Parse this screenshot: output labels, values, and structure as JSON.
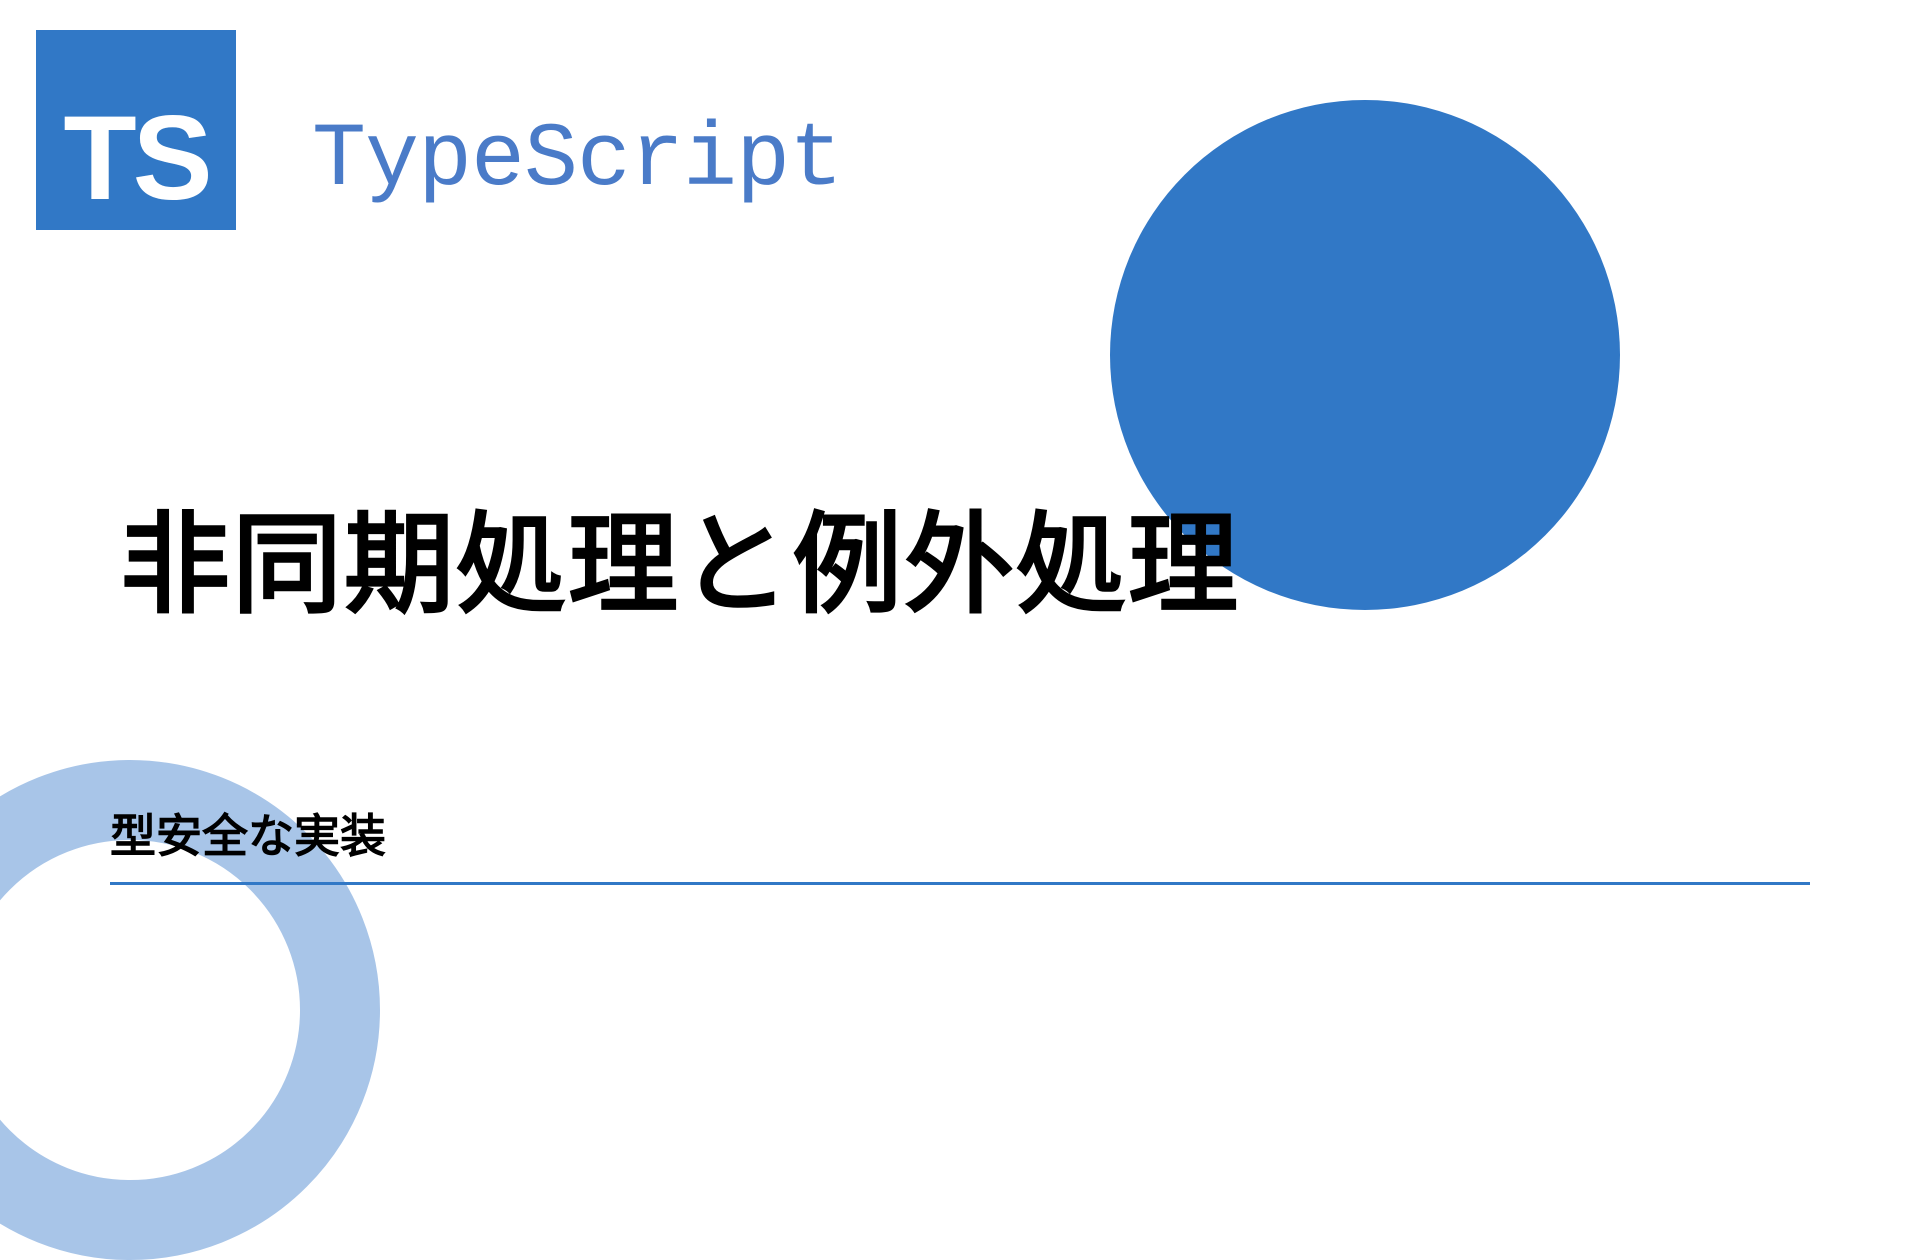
{
  "logo": {
    "text": "TS"
  },
  "brand": "TypeScript",
  "title": "非同期処理と例外処理",
  "subtitle": "型安全な実装",
  "colors": {
    "primary": "#3178c6",
    "ring": "#a8c5e8",
    "text": "#000000",
    "brand_text": "#4a7bc8"
  }
}
